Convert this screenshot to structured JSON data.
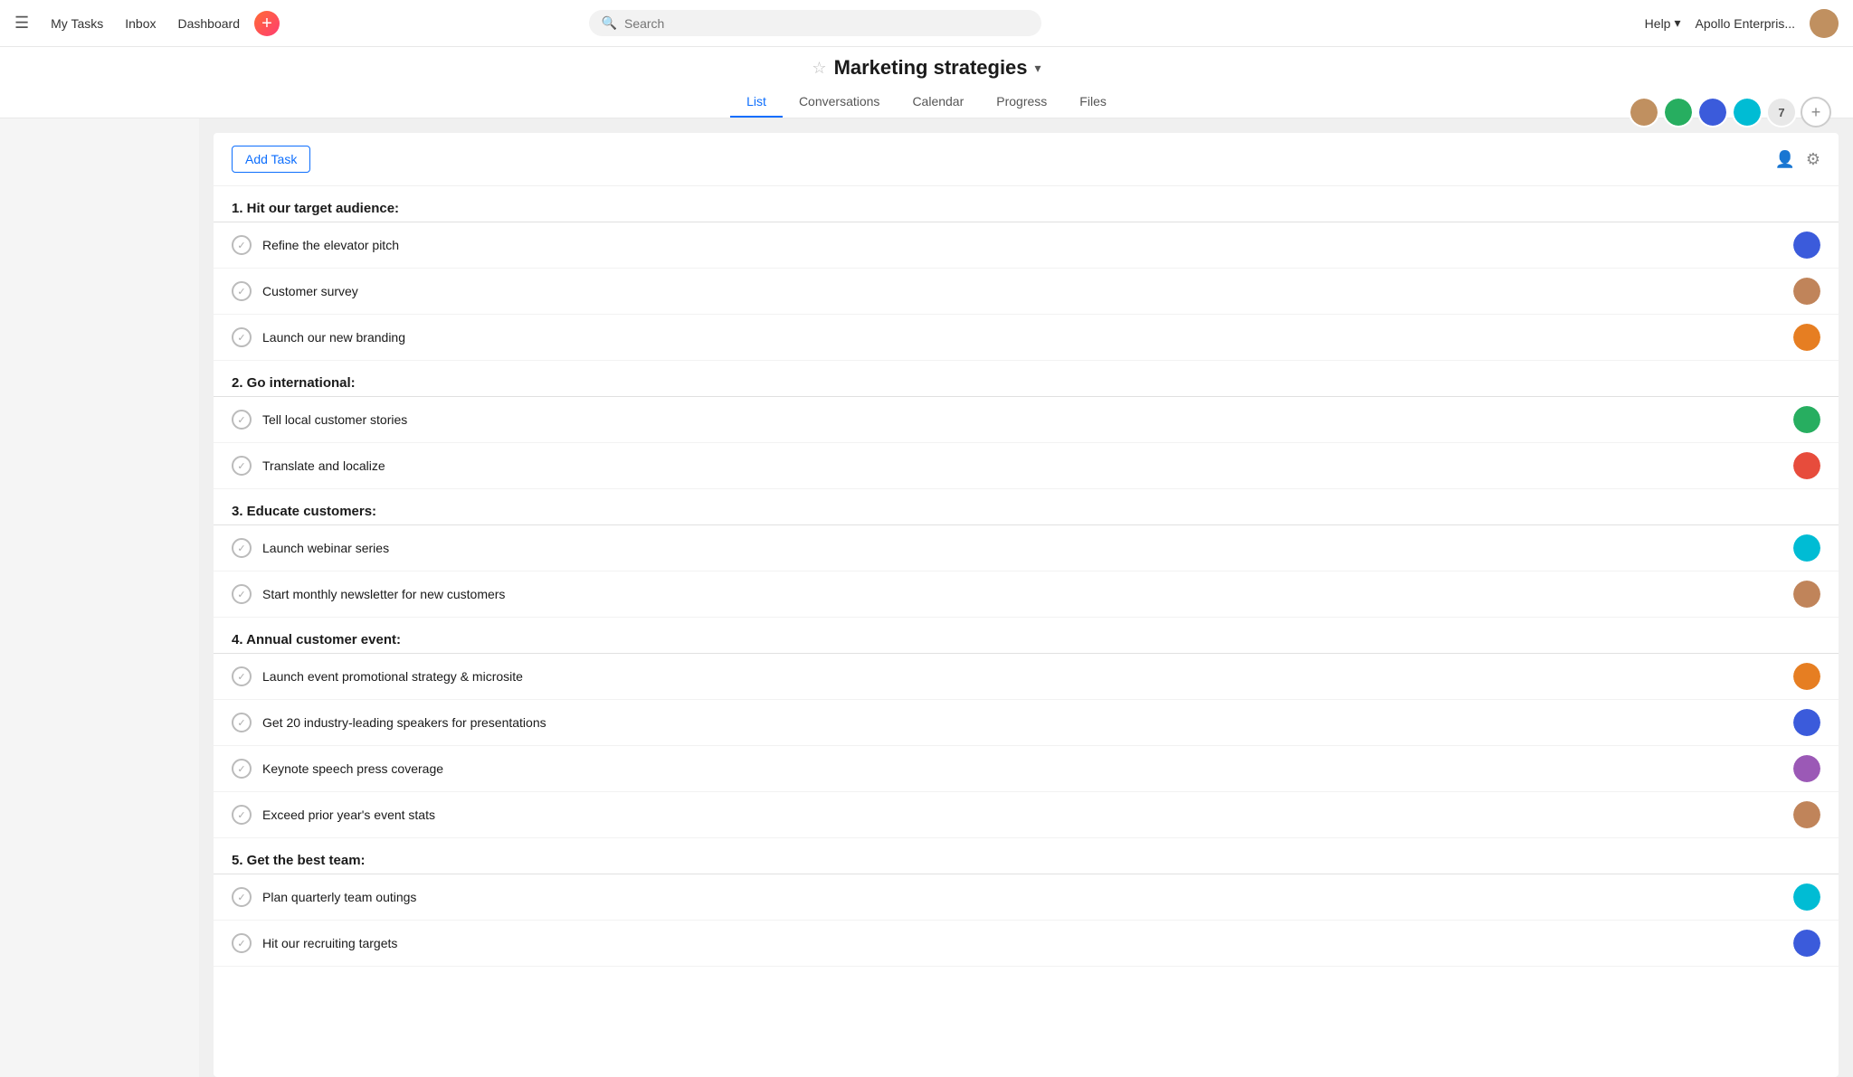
{
  "nav": {
    "hamburger_label": "☰",
    "my_tasks": "My Tasks",
    "inbox": "Inbox",
    "dashboard": "Dashboard",
    "add_btn_label": "+",
    "search_placeholder": "Search",
    "help_label": "Help",
    "help_arrow": "▾",
    "org_name": "Apollo Enterpris...",
    "user_initials": "U"
  },
  "project": {
    "star": "☆",
    "title": "Marketing strategies",
    "dropdown_arrow": "▾",
    "tabs": [
      {
        "id": "list",
        "label": "List",
        "active": true
      },
      {
        "id": "conversations",
        "label": "Conversations",
        "active": false
      },
      {
        "id": "calendar",
        "label": "Calendar",
        "active": false
      },
      {
        "id": "progress",
        "label": "Progress",
        "active": false
      },
      {
        "id": "files",
        "label": "Files",
        "active": false
      }
    ]
  },
  "team": {
    "count": "7",
    "add_label": "+"
  },
  "toolbar": {
    "add_task_label": "Add Task",
    "assign_icon": "👤",
    "settings_icon": "⚙"
  },
  "sections": [
    {
      "id": "section-1",
      "title": "1. Hit our target audience:",
      "tasks": [
        {
          "id": "t1",
          "name": "Refine the elevator pitch",
          "avatar_color": "av1"
        },
        {
          "id": "t2",
          "name": "Customer survey",
          "avatar_color": "av2"
        },
        {
          "id": "t3",
          "name": "Launch our new branding",
          "avatar_color": "av3"
        }
      ]
    },
    {
      "id": "section-2",
      "title": "2. Go international:",
      "tasks": [
        {
          "id": "t4",
          "name": "Tell local customer stories",
          "avatar_color": "av4"
        },
        {
          "id": "t5",
          "name": "Translate and localize",
          "avatar_color": "av5"
        }
      ]
    },
    {
      "id": "section-3",
      "title": "3. Educate customers:",
      "tasks": [
        {
          "id": "t6",
          "name": "Launch webinar series",
          "avatar_color": "av6"
        },
        {
          "id": "t7",
          "name": "Start monthly newsletter for new customers",
          "avatar_color": "av2"
        }
      ]
    },
    {
      "id": "section-4",
      "title": "4. Annual customer event:",
      "tasks": [
        {
          "id": "t8",
          "name": "Launch event promotional strategy & microsite",
          "avatar_color": "av3"
        },
        {
          "id": "t9",
          "name": "Get 20 industry-leading speakers for presentations",
          "avatar_color": "av1"
        },
        {
          "id": "t10",
          "name": "Keynote speech press coverage",
          "avatar_color": "av7"
        },
        {
          "id": "t11",
          "name": "Exceed prior year's event stats",
          "avatar_color": "av2"
        }
      ]
    },
    {
      "id": "section-5",
      "title": "5. Get the best team:",
      "tasks": [
        {
          "id": "t12",
          "name": "Plan quarterly team outings",
          "avatar_color": "av6"
        },
        {
          "id": "t13",
          "name": "Hit our recruiting targets",
          "avatar_color": "av1"
        }
      ]
    }
  ],
  "check_symbol": "✓"
}
